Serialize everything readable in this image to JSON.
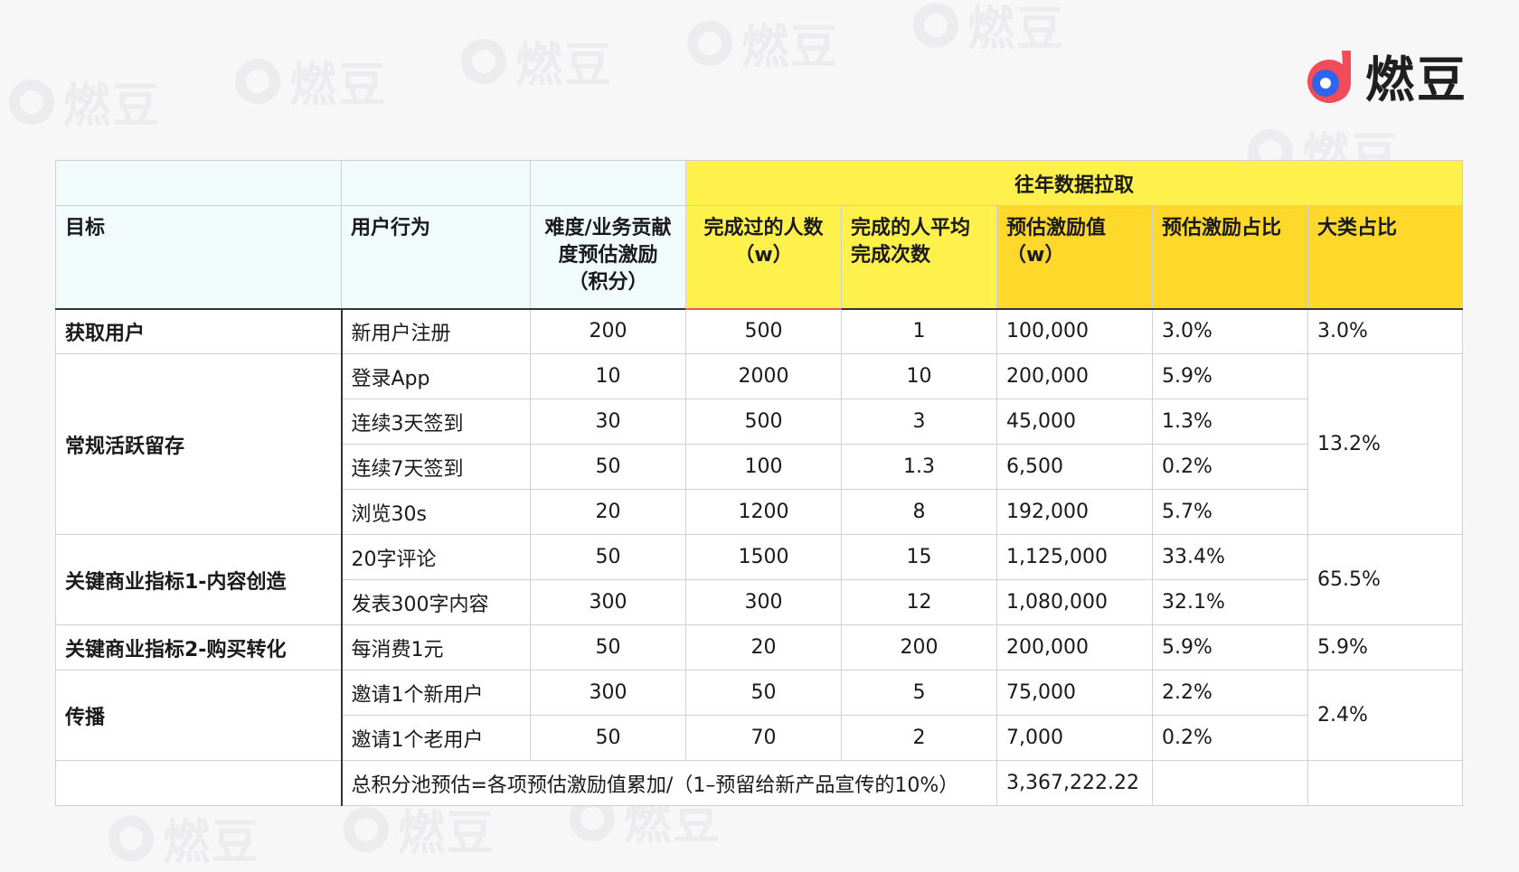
{
  "brand": {
    "name": "燃豆"
  },
  "watermark_text": "燃豆",
  "colors": {
    "header_yellow": "#fef14c",
    "header_gold": "#fed92c",
    "header_light": "#f1fbfc",
    "logo_blue": "#2f64ec",
    "logo_red": "#f24b5a"
  },
  "table": {
    "group_header": "往年数据拉取",
    "headers": [
      "目标",
      "用户行为",
      "难度/业务贡献度预估激励（积分）",
      "完成过的人数（w）",
      "完成的人平均完成次数",
      "预估激励值（w）",
      "预估激励占比",
      "大类占比"
    ],
    "rows": [
      {
        "goal": "获取用户",
        "action": "新用户注册",
        "points": "200",
        "users": "500",
        "avg": "1",
        "value": "100,000",
        "ratio": "3.0%",
        "cat": "3.0%"
      },
      {
        "goal": "常规活跃留存",
        "action": "登录App",
        "points": "10",
        "users": "2000",
        "avg": "10",
        "value": "200,000",
        "ratio": "5.9%",
        "cat": "13.2%"
      },
      {
        "action": "连续3天签到",
        "points": "30",
        "users": "500",
        "avg": "3",
        "value": "45,000",
        "ratio": "1.3%"
      },
      {
        "action": "连续7天签到",
        "points": "50",
        "users": "100",
        "avg": "1.3",
        "value": "6,500",
        "ratio": "0.2%"
      },
      {
        "action": "浏览30s",
        "points": "20",
        "users": "1200",
        "avg": "8",
        "value": "192,000",
        "ratio": "5.7%"
      },
      {
        "goal": "关键商业指标1-内容创造",
        "action": "20字评论",
        "points": "50",
        "users": "1500",
        "avg": "15",
        "value": "1,125,000",
        "ratio": "33.4%",
        "cat": "65.5%"
      },
      {
        "action": "发表300字内容",
        "points": "300",
        "users": "300",
        "avg": "12",
        "value": "1,080,000",
        "ratio": "32.1%"
      },
      {
        "goal": "关键商业指标2-购买转化",
        "action": "每消费1元",
        "points": "50",
        "users": "20",
        "avg": "200",
        "value": "200,000",
        "ratio": "5.9%",
        "cat": "5.9%"
      },
      {
        "goal": "传播",
        "action": "邀请1个新用户",
        "points": "300",
        "users": "50",
        "avg": "5",
        "value": "75,000",
        "ratio": "2.2%",
        "cat": "2.4%"
      },
      {
        "action": "邀请1个老用户",
        "points": "50",
        "users": "70",
        "avg": "2",
        "value": "7,000",
        "ratio": "0.2%"
      }
    ],
    "total": {
      "label": "总积分池预估=各项预估激励值累加/（1–预留给新产品宣传的10%）",
      "value": "3,367,222.22"
    }
  }
}
